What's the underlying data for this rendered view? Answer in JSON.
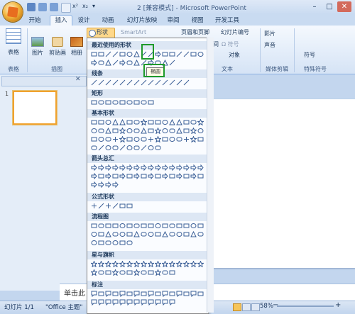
{
  "window": {
    "title": "2 [兼容模式] - Microsoft PowerPoint",
    "min": "–",
    "max": "□",
    "close": "✕"
  },
  "tabs": [
    {
      "label": "开始"
    },
    {
      "label": "插入"
    },
    {
      "label": "设计"
    },
    {
      "label": "动画"
    },
    {
      "label": "幻灯片放映"
    },
    {
      "label": "审阅"
    },
    {
      "label": "视图"
    },
    {
      "label": "开发工具"
    }
  ],
  "ribbon": {
    "table": "表格",
    "picture": "图片",
    "clipart": "剪贴画",
    "album": "相册",
    "shapes": "形状",
    "smartart": "SmartArt",
    "header_footer": "页眉和页脚",
    "slide_number": "幻灯片编号",
    "time": "时间",
    "symbol": "Ω 符号",
    "object": "对象",
    "movie": "影片",
    "sound": "声音",
    "symbols_item": "符号",
    "groups": {
      "tables": "表格",
      "illustrations": "插图",
      "text": "文本",
      "media": "媒体剪辑",
      "special": "特殊符号"
    }
  },
  "shapes_panel": {
    "sections": [
      "最近使用的形状",
      "线条",
      "矩形",
      "基本形状",
      "箭头总汇",
      "公式形状",
      "流程图",
      "星与旗帜",
      "标注"
    ],
    "tooltip": "椭圆"
  },
  "slides_pane": {
    "slide_number": "1"
  },
  "notes": {
    "placeholder": "单击此"
  },
  "statusbar": {
    "slide": "幻灯片 1/1",
    "theme": "\"Office 主题\"",
    "zoom": "58%"
  }
}
